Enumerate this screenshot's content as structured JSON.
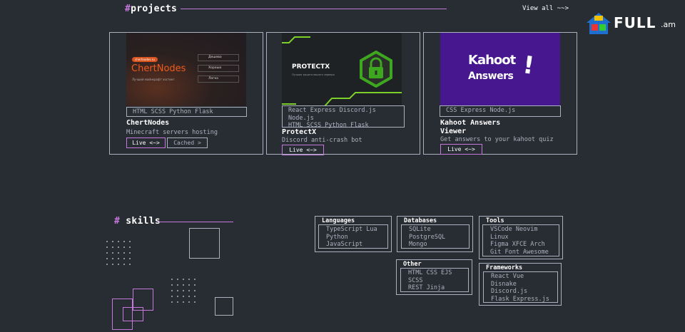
{
  "projects": {
    "hash": "#",
    "title": "projects",
    "view_all": "View all ~~>",
    "cards": [
      {
        "thumb": {
          "badge": "chertnodes.ru",
          "logo": "ChertNodes",
          "tagline": "Лучший майнкрафт хостинг",
          "menu": [
            "Дешево",
            "Хорошо",
            "Легко"
          ]
        },
        "tags": "HTML SCSS Python Flask",
        "title": "ChertNodes",
        "desc": "Minecraft servers hosting",
        "live": "Live <~>",
        "cached": "Cached >"
      },
      {
        "thumb": {
          "logo": "PROTECTX",
          "tagline": "Лучшая защита вашего сервера"
        },
        "tags": [
          "React Express Discord.js",
          "Node.js",
          "HTML SCSS Python Flask"
        ],
        "title": "ProtectX",
        "desc": "Discord anti-crash bot",
        "live": "Live <~>"
      },
      {
        "thumb": {
          "line1": "Kahoot",
          "line2": "Answers"
        },
        "tags": "CSS Express Node.js",
        "title_line1": "Kahoot Answers",
        "title_line2": "Viewer",
        "desc": "Get answers to your kahoot quiz",
        "live": "Live <~>"
      }
    ]
  },
  "skills": {
    "hash": "#",
    "title": "skills",
    "groups": {
      "languages": {
        "title": "Languages",
        "items": [
          "TypeScript Lua",
          "Python",
          "JavaScript"
        ]
      },
      "databases": {
        "title": "Databases",
        "items": [
          "SQLite",
          "PostgreSQL",
          "Mongo"
        ]
      },
      "tools": {
        "title": "Tools",
        "items": [
          "VSCode Neovim",
          "Linux",
          "Figma XFCE Arch",
          "Git Font Awesome"
        ]
      },
      "other": {
        "title": "Other",
        "items": [
          "HTML CSS EJS",
          "SCSS",
          "REST Jinja"
        ]
      },
      "frameworks": {
        "title": "Frameworks",
        "items": [
          "React Vue",
          "Disnake",
          "Discord.js",
          "Flask Express.js"
        ]
      }
    }
  },
  "watermark": {
    "brand": "FULL",
    "suffix": ".am"
  },
  "colors": {
    "bg": "#282c33",
    "accent": "#c778dd",
    "gray": "#abb2bf",
    "kahoot": "#46178f",
    "protect_green": "#3da81f"
  }
}
